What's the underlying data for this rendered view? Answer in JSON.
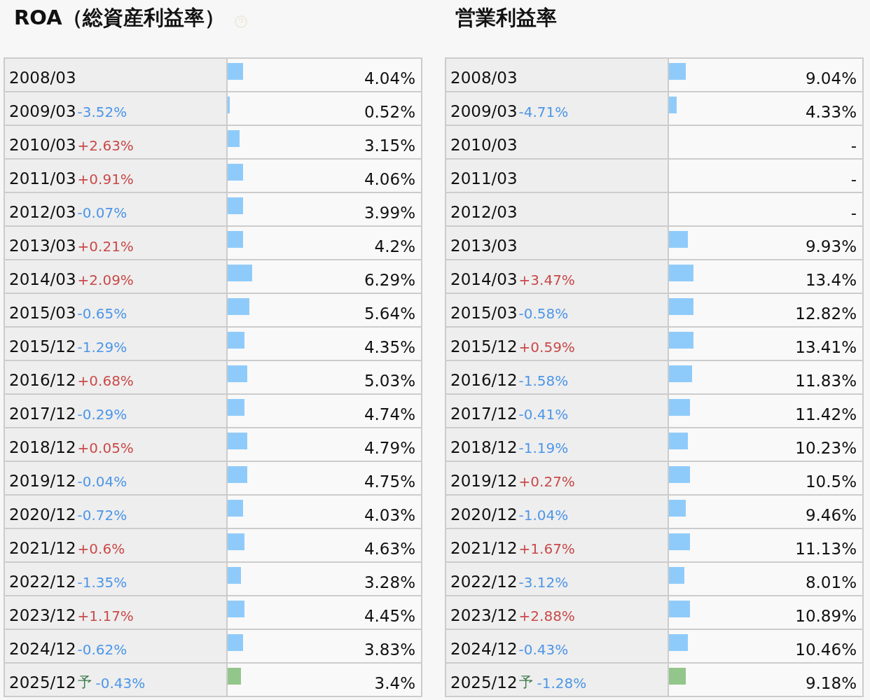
{
  "panels": [
    {
      "title": "ROA（総資産利益率）",
      "help": true,
      "rows": [
        {
          "period": "2008/03",
          "kind": "actual",
          "value": "4.04%",
          "level": 0.08
        },
        {
          "period": "2009/03",
          "kind": "actual",
          "change": "-3.52%",
          "rising": false,
          "value": "0.52%",
          "level": 0.011
        },
        {
          "period": "2010/03",
          "kind": "actual",
          "change": "+2.63%",
          "rising": true,
          "value": "3.15%",
          "level": 0.063
        },
        {
          "period": "2011/03",
          "kind": "actual",
          "change": "+0.91%",
          "rising": true,
          "value": "4.06%",
          "level": 0.08
        },
        {
          "period": "2012/03",
          "kind": "actual",
          "change": "-0.07%",
          "rising": false,
          "value": "3.99%",
          "level": 0.08
        },
        {
          "period": "2013/03",
          "kind": "actual",
          "change": "+0.21%",
          "rising": true,
          "value": "4.2%",
          "level": 0.08
        },
        {
          "period": "2014/03",
          "kind": "actual",
          "change": "+2.09%",
          "rising": true,
          "value": "6.29%",
          "level": 0.128
        },
        {
          "period": "2015/03",
          "kind": "actual",
          "change": "-0.65%",
          "rising": false,
          "value": "5.64%",
          "level": 0.113
        },
        {
          "period": "2015/12",
          "kind": "actual",
          "change": "-1.29%",
          "rising": false,
          "value": "4.35%",
          "level": 0.088
        },
        {
          "period": "2016/12",
          "kind": "actual",
          "change": "+0.68%",
          "rising": true,
          "value": "5.03%",
          "level": 0.102
        },
        {
          "period": "2017/12",
          "kind": "actual",
          "change": "-0.29%",
          "rising": false,
          "value": "4.74%",
          "level": 0.088
        },
        {
          "period": "2018/12",
          "kind": "actual",
          "change": "+0.05%",
          "rising": true,
          "value": "4.79%",
          "level": 0.102
        },
        {
          "period": "2019/12",
          "kind": "actual",
          "change": "-0.04%",
          "rising": false,
          "value": "4.75%",
          "level": 0.102
        },
        {
          "period": "2020/12",
          "kind": "actual",
          "change": "-0.72%",
          "rising": false,
          "value": "4.03%",
          "level": 0.08
        },
        {
          "period": "2021/12",
          "kind": "actual",
          "change": "+0.6%",
          "rising": true,
          "value": "4.63%",
          "level": 0.088
        },
        {
          "period": "2022/12",
          "kind": "actual",
          "change": "-1.35%",
          "rising": false,
          "value": "3.28%",
          "level": 0.07
        },
        {
          "period": "2023/12",
          "kind": "actual",
          "change": "+1.17%",
          "rising": true,
          "value": "4.45%",
          "level": 0.088
        },
        {
          "period": "2024/12",
          "kind": "actual",
          "change": "-0.62%",
          "rising": false,
          "value": "3.83%",
          "level": 0.08
        },
        {
          "period": "2025/12",
          "kind": "forecast",
          "forecast_mark": "予",
          "change": "-0.43%",
          "rising": false,
          "value": "3.4%",
          "level": 0.07
        }
      ]
    },
    {
      "title": "営業利益率",
      "help": false,
      "rows": [
        {
          "period": "2008/03",
          "kind": "actual",
          "value": "9.04%",
          "level": 0.087
        },
        {
          "period": "2009/03",
          "kind": "actual",
          "change": "-4.71%",
          "rising": false,
          "value": "4.33%",
          "level": 0.04
        },
        {
          "period": "2010/03",
          "value": "-"
        },
        {
          "period": "2011/03",
          "value": "-"
        },
        {
          "period": "2012/03",
          "value": "-"
        },
        {
          "period": "2013/03",
          "kind": "actual",
          "value": "9.93%",
          "level": 0.098
        },
        {
          "period": "2014/03",
          "kind": "actual",
          "change": "+3.47%",
          "rising": true,
          "value": "13.4%",
          "level": 0.127
        },
        {
          "period": "2015/03",
          "kind": "actual",
          "change": "-0.58%",
          "rising": false,
          "value": "12.82%",
          "level": 0.127
        },
        {
          "period": "2015/12",
          "kind": "actual",
          "change": "+0.59%",
          "rising": true,
          "value": "13.41%",
          "level": 0.127
        },
        {
          "period": "2016/12",
          "kind": "actual",
          "change": "-1.58%",
          "rising": false,
          "value": "11.83%",
          "level": 0.12
        },
        {
          "period": "2017/12",
          "kind": "actual",
          "change": "-0.41%",
          "rising": false,
          "value": "11.42%",
          "level": 0.11
        },
        {
          "period": "2018/12",
          "kind": "actual",
          "change": "-1.19%",
          "rising": false,
          "value": "10.23%",
          "level": 0.098
        },
        {
          "period": "2019/12",
          "kind": "actual",
          "change": "+0.27%",
          "rising": true,
          "value": "10.5%",
          "level": 0.11
        },
        {
          "period": "2020/12",
          "kind": "actual",
          "change": "-1.04%",
          "rising": false,
          "value": "9.46%",
          "level": 0.087
        },
        {
          "period": "2021/12",
          "kind": "actual",
          "change": "+1.67%",
          "rising": true,
          "value": "11.13%",
          "level": 0.11
        },
        {
          "period": "2022/12",
          "kind": "actual",
          "change": "-3.12%",
          "rising": false,
          "value": "8.01%",
          "level": 0.08
        },
        {
          "period": "2023/12",
          "kind": "actual",
          "change": "+2.88%",
          "rising": true,
          "value": "10.89%",
          "level": 0.11
        },
        {
          "period": "2024/12",
          "kind": "actual",
          "change": "-0.43%",
          "rising": false,
          "value": "10.46%",
          "level": 0.098
        },
        {
          "period": "2025/12",
          "kind": "forecast",
          "forecast_mark": "予",
          "change": "-1.28%",
          "rising": false,
          "value": "9.18%",
          "level": 0.087
        }
      ]
    }
  ]
}
